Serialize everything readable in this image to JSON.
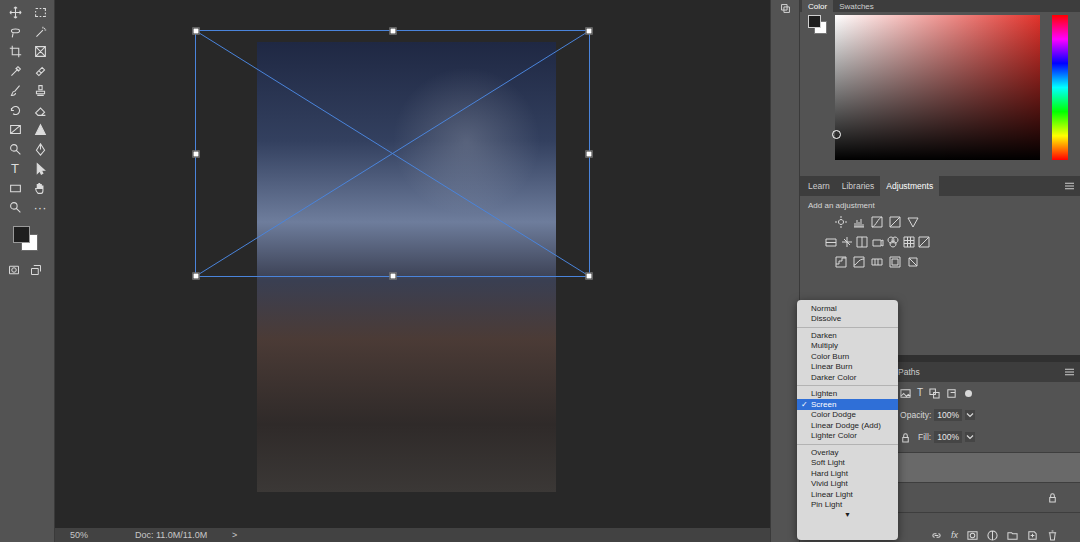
{
  "toolbar": {
    "type_glyph": "T",
    "more_glyph": "···"
  },
  "document": {
    "zoom": "50%",
    "size": "Doc: 11.0M/11.0M",
    "arrow": ">"
  },
  "color_panel": {
    "tabs": [
      {
        "label": "Color",
        "selected": true
      },
      {
        "label": "Swatches",
        "selected": false
      }
    ]
  },
  "adjustments_panel": {
    "tabs": [
      {
        "label": "Learn",
        "selected": false
      },
      {
        "label": "Libraries",
        "selected": false
      },
      {
        "label": "Adjustments",
        "selected": true
      }
    ],
    "hint": "Add an adjustment"
  },
  "layers_panel": {
    "tabs": [
      {
        "label": "Paths",
        "selected": false
      }
    ],
    "filter_glyph": "T",
    "opacity_label": "Opacity:",
    "opacity": "100%",
    "fill_label": "Fill:",
    "fill": "100%",
    "footer_fx": "fx",
    "layers": [
      {
        "selected": true,
        "locked": false
      },
      {
        "selected": false,
        "locked": true
      }
    ]
  },
  "blend_menu": {
    "check": "✓",
    "more": "▼",
    "groups": [
      [
        {
          "label": "Normal",
          "selected": false
        },
        {
          "label": "Dissolve",
          "selected": false
        }
      ],
      [
        {
          "label": "Darken",
          "selected": false
        },
        {
          "label": "Multiply",
          "selected": false
        },
        {
          "label": "Color Burn",
          "selected": false
        },
        {
          "label": "Linear Burn",
          "selected": false
        },
        {
          "label": "Darker Color",
          "selected": false
        }
      ],
      [
        {
          "label": "Lighten",
          "selected": false
        },
        {
          "label": "Screen",
          "selected": true
        },
        {
          "label": "Color Dodge",
          "selected": false
        },
        {
          "label": "Linear Dodge (Add)",
          "selected": false
        },
        {
          "label": "Lighter Color",
          "selected": false
        }
      ],
      [
        {
          "label": "Overlay",
          "selected": false
        },
        {
          "label": "Soft Light",
          "selected": false
        },
        {
          "label": "Hard Light",
          "selected": false
        },
        {
          "label": "Vivid Light",
          "selected": false
        },
        {
          "label": "Linear Light",
          "selected": false
        },
        {
          "label": "Pin Light",
          "selected": false
        }
      ]
    ]
  }
}
